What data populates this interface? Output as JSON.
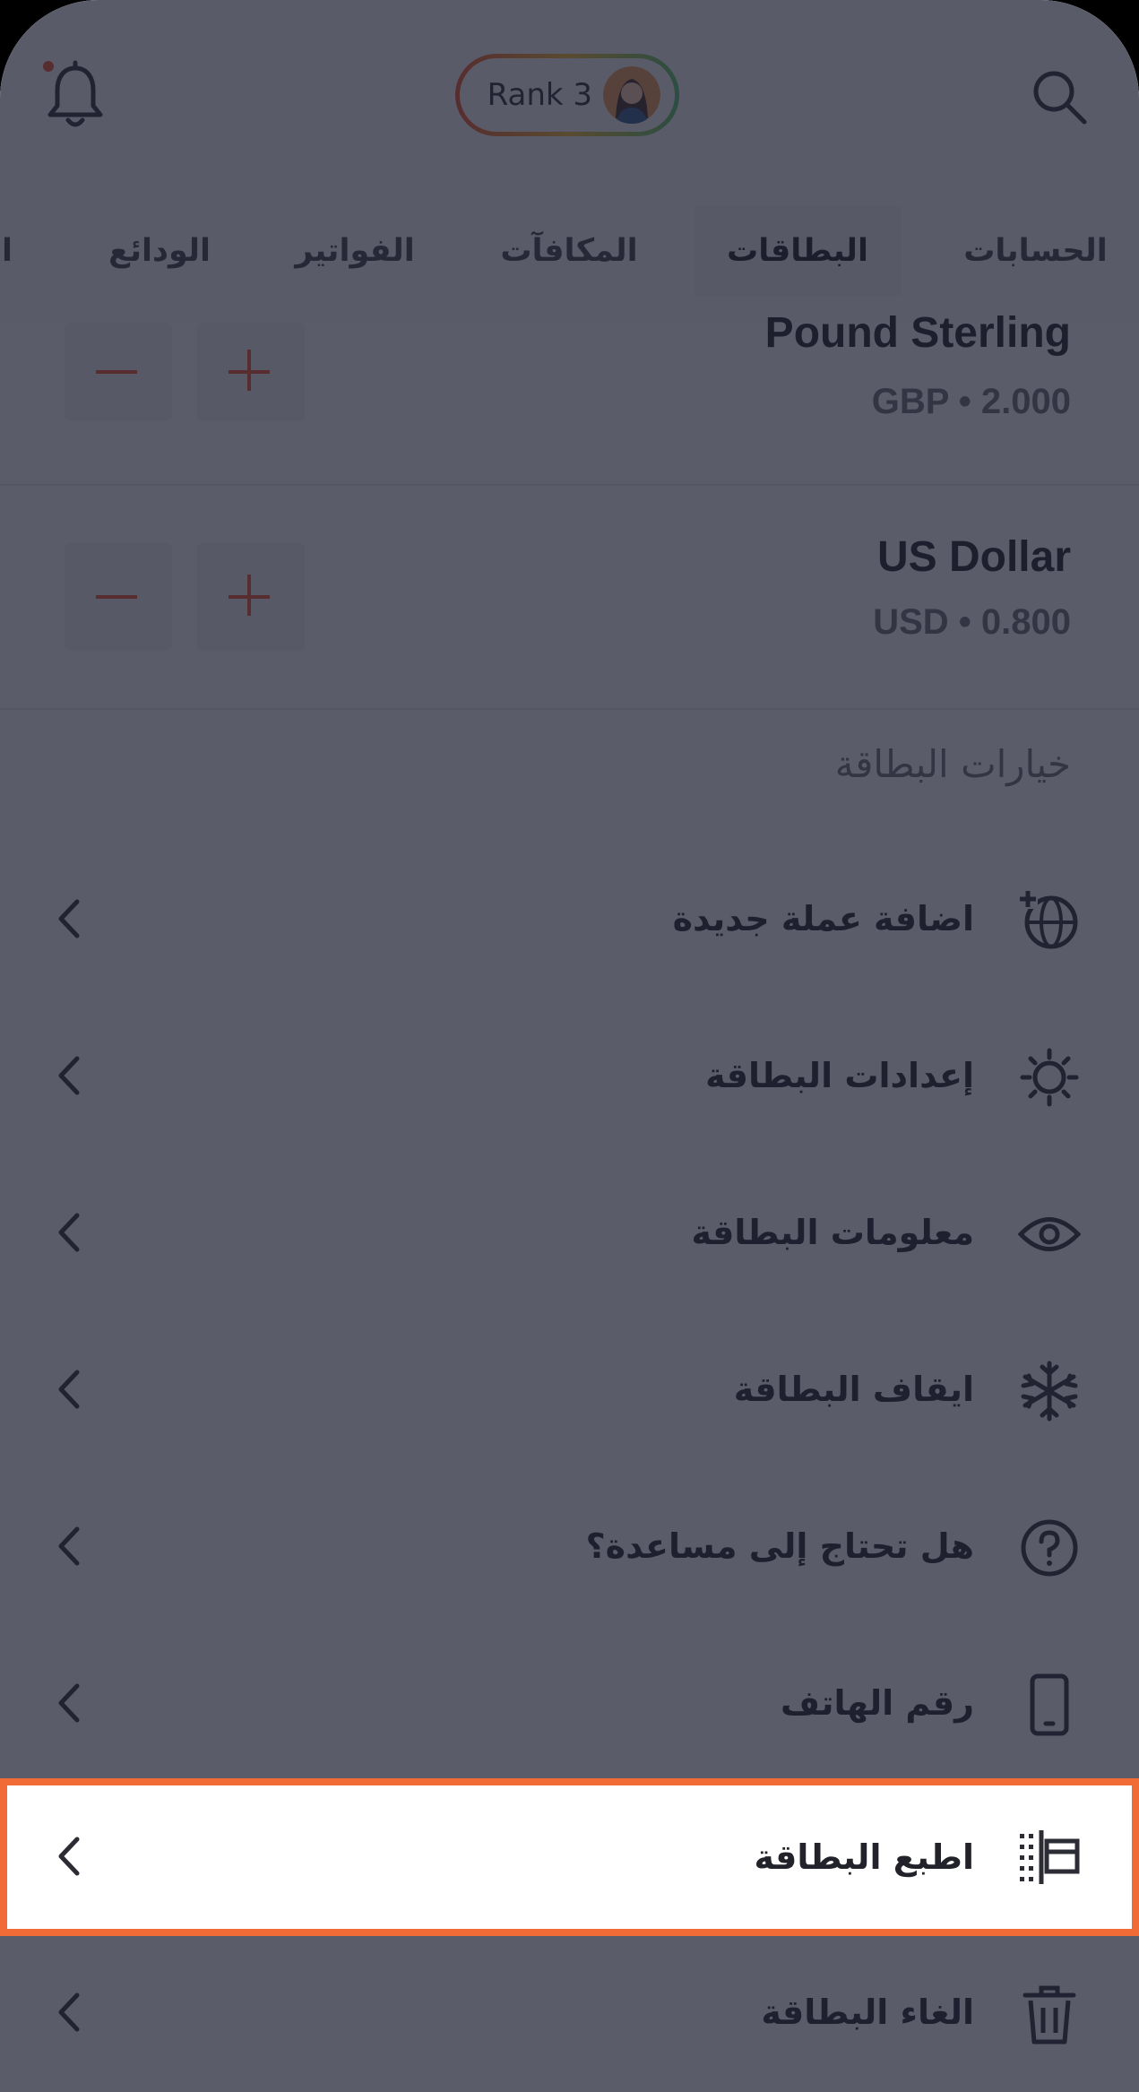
{
  "header": {
    "rank_label": "Rank 3",
    "icons": {
      "left": "bell-icon",
      "right": "search-icon",
      "avatar": "user-avatar"
    },
    "tabs": [
      {
        "label": "الحسابات"
      },
      {
        "label": "البطاقات",
        "active": true
      },
      {
        "label": "المكافآت"
      },
      {
        "label": "الفواتير"
      },
      {
        "label": "الودائع"
      },
      {
        "label": "ا"
      }
    ]
  },
  "currencies": [
    {
      "name": "Pound Sterling",
      "code_value": "GBP • 2.000"
    },
    {
      "name": "US Dollar",
      "code_value": "USD • 0.800"
    }
  ],
  "card_options": {
    "title": "خيارات البطاقة",
    "items": [
      {
        "label": "اضافة عملة جديدة",
        "icon": "globe-plus-icon"
      },
      {
        "label": "إعدادات البطاقة",
        "icon": "gear-icon"
      },
      {
        "label": "معلومات البطاقة",
        "icon": "eye-icon"
      },
      {
        "label": "ايقاف البطاقة",
        "icon": "snowflake-icon"
      },
      {
        "label": "هل تحتاج إلى مساعدة؟",
        "icon": "help-icon"
      },
      {
        "label": "رقم الهاتف",
        "icon": "phone-icon"
      },
      {
        "label": "اطبع البطاقة",
        "icon": "print-card-icon",
        "highlighted": true
      },
      {
        "label": "الغاء البطاقة",
        "icon": "trash-icon"
      }
    ]
  },
  "colors": {
    "accent": "#f06b35",
    "overlay": "#1e2032"
  }
}
